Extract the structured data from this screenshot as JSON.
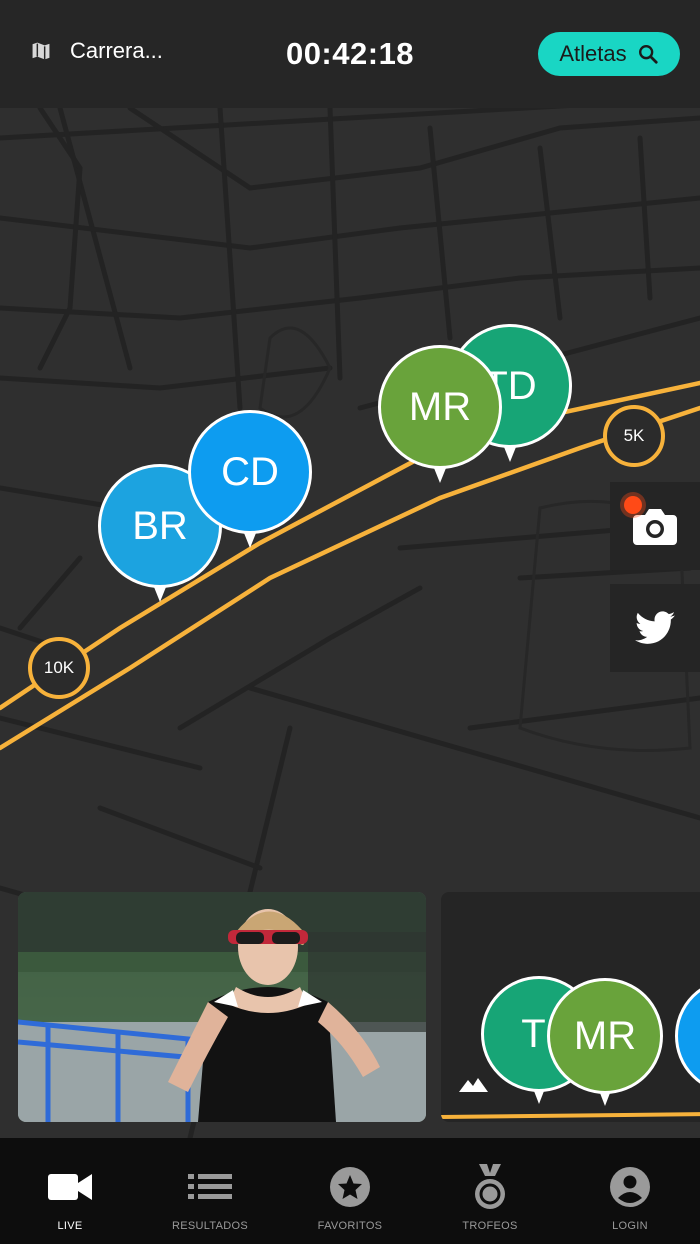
{
  "header": {
    "race_title": "Carrera...",
    "elapsed_time": "00:42:18",
    "athletes_button": "Atletas",
    "accent_color": "#19d6c4"
  },
  "map": {
    "distance_markers": [
      "10K",
      "5K"
    ],
    "runners": [
      {
        "initials": "BR",
        "color": "#1ca3e0"
      },
      {
        "initials": "CD",
        "color": "#0d9cf0"
      },
      {
        "initials": "TD",
        "color": "#17a576"
      },
      {
        "initials": "MR",
        "color": "#69a33b"
      }
    ],
    "route_color": "#f7b23b"
  },
  "side_actions": [
    "camera-icon",
    "twitter-icon"
  ],
  "cards": {
    "mini_runners": [
      {
        "initials": "TI",
        "color": "#17a576"
      },
      {
        "initials": "MR",
        "color": "#69a33b"
      }
    ]
  },
  "tabbar": {
    "tabs": [
      {
        "label": "LIVE",
        "icon": "video-camera-icon"
      },
      {
        "label": "RESULTADOS",
        "icon": "list-icon"
      },
      {
        "label": "FAVORITOS",
        "icon": "star-icon"
      },
      {
        "label": "TROFEOS",
        "icon": "medal-icon"
      },
      {
        "label": "LOGIN",
        "icon": "user-icon"
      }
    ]
  }
}
